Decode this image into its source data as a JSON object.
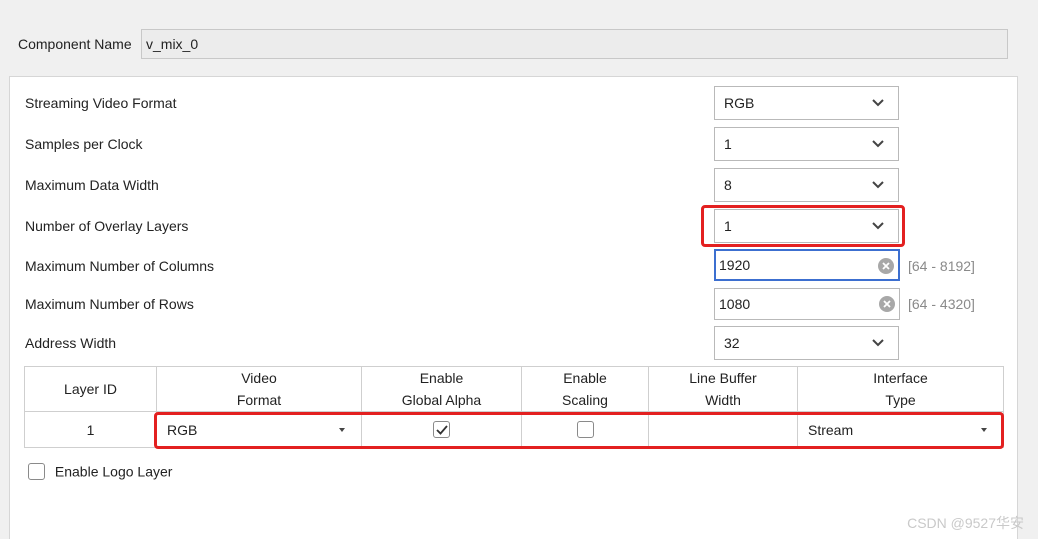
{
  "component": {
    "label": "Component Name",
    "value": "v_mix_0"
  },
  "fields": {
    "streaming_video_format": {
      "label": "Streaming Video Format",
      "value": "RGB"
    },
    "samples_per_clock": {
      "label": "Samples per Clock",
      "value": "1"
    },
    "max_data_width": {
      "label": "Maximum Data Width",
      "value": "8"
    },
    "num_overlay_layers": {
      "label": "Number of Overlay Layers",
      "value": "1"
    },
    "max_columns": {
      "label": "Maximum Number of Columns",
      "value": "1920",
      "range": "[64 - 8192]"
    },
    "max_rows": {
      "label": "Maximum Number of Rows",
      "value": "1080",
      "range": "[64 - 4320]"
    },
    "address_width": {
      "label": "Address Width",
      "value": "32"
    }
  },
  "layer_table": {
    "headers": {
      "layer_id": "Layer ID",
      "video_format_1": "Video",
      "video_format_2": "Format",
      "global_alpha_1": "Enable",
      "global_alpha_2": "Global Alpha",
      "scaling_1": "Enable",
      "scaling_2": "Scaling",
      "line_buffer_1": "Line Buffer",
      "line_buffer_2": "Width",
      "interface_1": "Interface",
      "interface_2": "Type"
    },
    "rows": [
      {
        "layer_id": "1",
        "video_format": "RGB",
        "global_alpha": true,
        "scaling": false,
        "line_buffer_width": "",
        "interface_type": "Stream"
      }
    ]
  },
  "logo_layer": {
    "label": "Enable Logo Layer",
    "checked": false
  },
  "watermark": "CSDN @9527华安",
  "colors": {
    "highlight": "#e32020",
    "focus": "#3c6fd0"
  }
}
